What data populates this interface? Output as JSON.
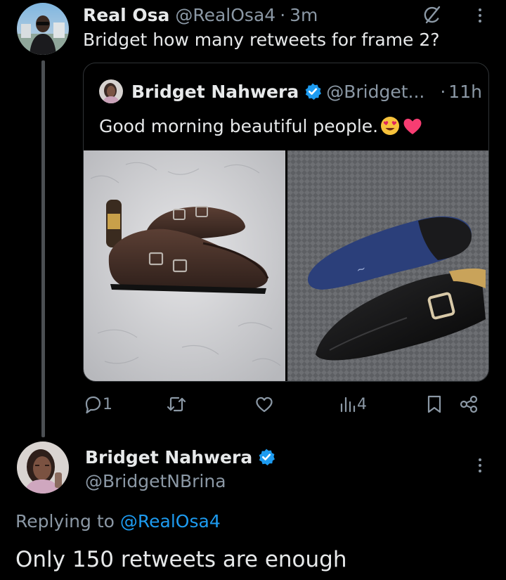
{
  "colors": {
    "background": "#000000",
    "text_primary": "#e7e9ea",
    "text_muted": "#8b98a5",
    "accent_blue": "#1d9bf0",
    "border": "#2f3336",
    "thread_line": "#4b4f53"
  },
  "tweet": {
    "author_name": "Real Osa",
    "author_handle": "@RealOsa4",
    "separator": "·",
    "time": "3m",
    "text": "Bridget how many retweets for frame 2?",
    "icons": [
      "grok-icon",
      "more-options-icon"
    ],
    "quoted": {
      "author_name": "Bridget Nahwera",
      "author_handle": "@Bridget...",
      "separator": "·",
      "time": "11h",
      "text": "Good morning beautiful people.",
      "emojis": [
        "heart-eyes-emoji",
        "pink-heart-emoji"
      ],
      "images": [
        "brown-monk-strap-shoes-photo",
        "black-monk-strap-shoes-photo"
      ]
    },
    "actions": {
      "replies": "1",
      "retweets": "",
      "likes": "",
      "views": "4",
      "icons": [
        "reply-icon",
        "retweet-icon",
        "like-icon",
        "views-icon",
        "bookmark-icon",
        "share-icon"
      ]
    }
  },
  "reply": {
    "author_name": "Bridget Nahwera",
    "author_handle": "@BridgetNBrina",
    "replying_label": "Replying to",
    "replying_to": "@RealOsa4",
    "text": "Only 150 retweets are enough"
  }
}
